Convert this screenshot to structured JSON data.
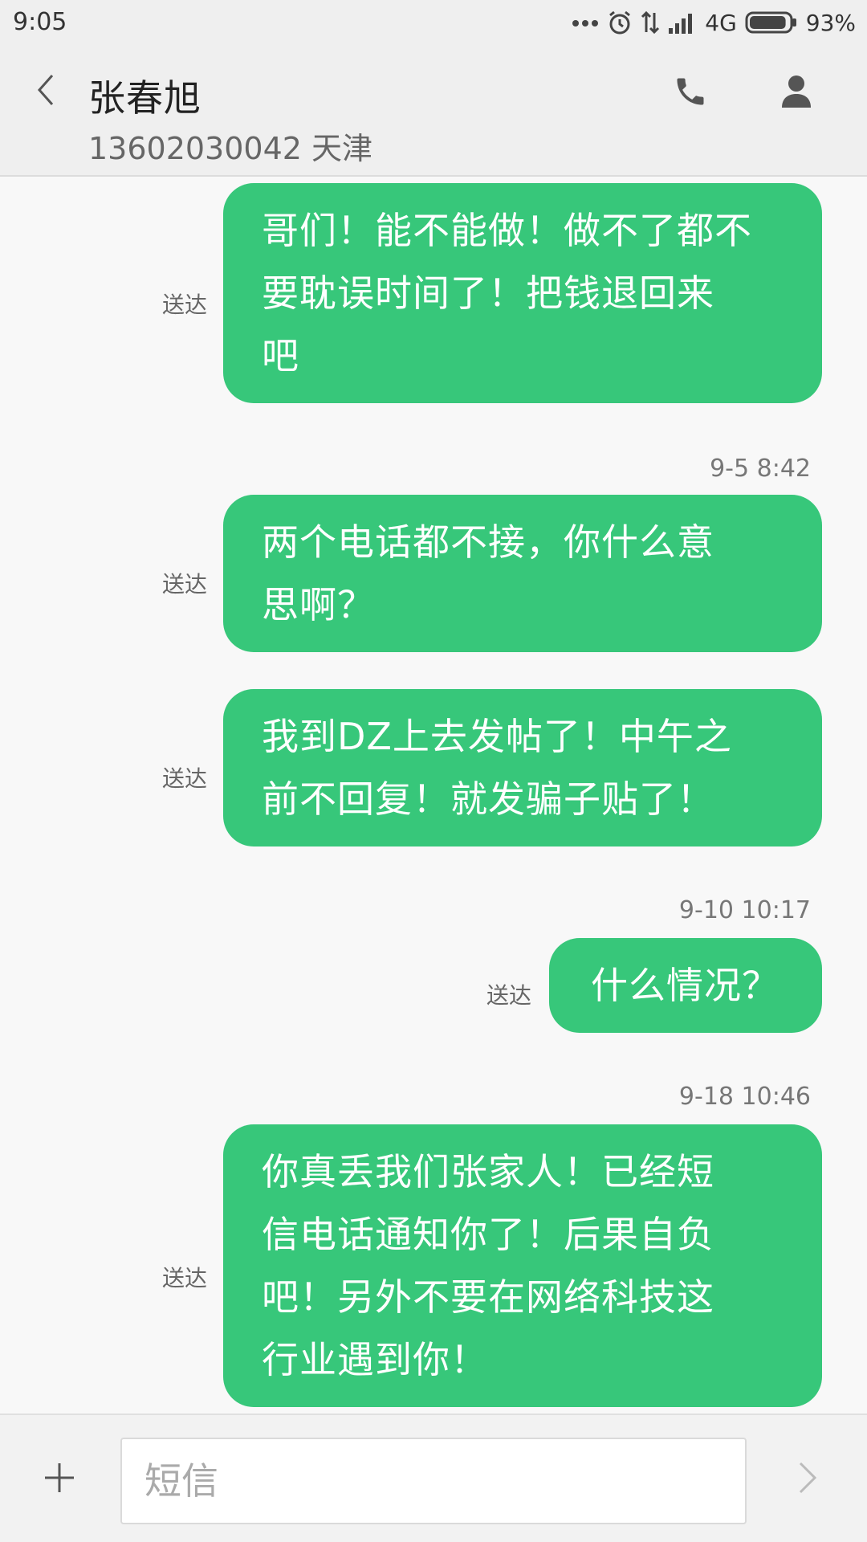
{
  "status_bar": {
    "time": "9:05",
    "network": "4G",
    "battery_percent": "93%",
    "battery_level": 0.93,
    "icons": [
      "more-dots-icon",
      "alarm-icon",
      "data-arrows-icon",
      "signal-icon",
      "battery-icon"
    ]
  },
  "header": {
    "contact_name": "张春旭",
    "contact_subtitle": "13602030042 天津",
    "icons": [
      "back-arrow-icon",
      "phone-icon",
      "person-icon"
    ]
  },
  "messages": [
    {
      "text_lines": [
        "哥们！能不能做！做不了都不",
        "要耽误时间了！把钱退回来",
        "吧"
      ],
      "status": "送达"
    },
    {
      "timestamp": "9-5 8:42"
    },
    {
      "text_lines": [
        "两个电话都不接，你什么意",
        "思啊？"
      ],
      "status": "送达"
    },
    {
      "text_lines": [
        "我到DZ上去发帖了！中午之",
        "前不回复！就发骗子贴了！"
      ],
      "status": "送达"
    },
    {
      "timestamp": "9-10 10:17"
    },
    {
      "text_lines": [
        "什么情况？"
      ],
      "status": "送达"
    },
    {
      "timestamp": "9-18 10:46"
    },
    {
      "text_lines": [
        "你真丢我们张家人！已经短",
        "信电话通知你了！后果自负",
        "吧！另外不要在网络科技这",
        "行业遇到你！"
      ],
      "status": "送达"
    }
  ],
  "input_bar": {
    "placeholder": "短信",
    "value": "",
    "icons": [
      "plus-icon",
      "send-chevron-icon"
    ]
  },
  "colors": {
    "bubble": "#37c77a",
    "bubble_text": "#ffffff",
    "background": "#f8f8f8",
    "header_bg": "#efefef"
  }
}
